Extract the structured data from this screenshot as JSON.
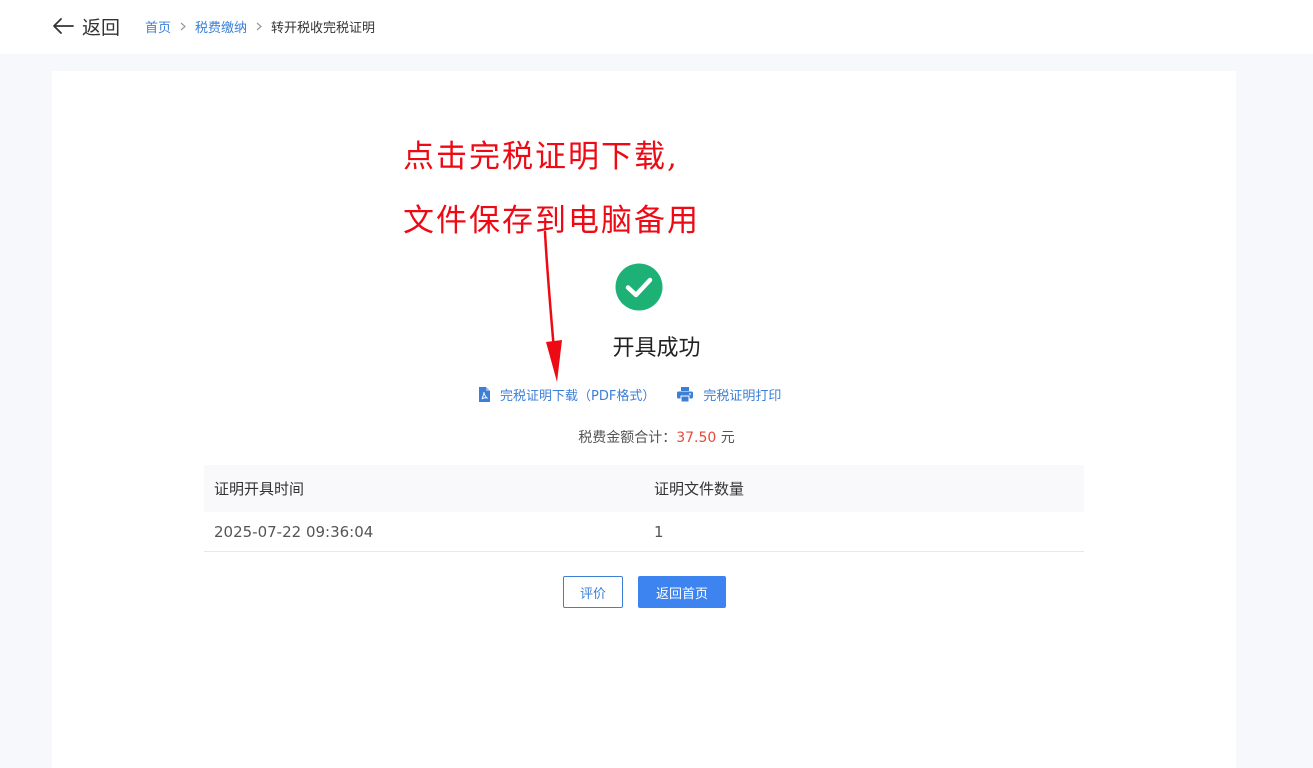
{
  "header": {
    "back_label": "返回",
    "breadcrumb": {
      "home": "首页",
      "section": "税费缴纳",
      "current": "转开税收完税证明"
    }
  },
  "annotation": {
    "line1": "点击完税证明下载,",
    "line2": "文件保存到电脑备用"
  },
  "result": {
    "title": "开具成功",
    "download_link": "完税证明下载（PDF格式）",
    "print_link": "完税证明打印",
    "summary_label": "税费金额合计：",
    "amount": "37.50",
    "currency": "元"
  },
  "table": {
    "headers": [
      "证明开具时间",
      "证明文件数量"
    ],
    "rows": [
      [
        "2025-07-22 09:36:04",
        "1"
      ]
    ]
  },
  "actions": {
    "review": "评价",
    "home": "返回首页"
  },
  "colors": {
    "link": "#3c7fd6",
    "primary": "#3d84f0",
    "success": "#1eb176",
    "amount": "#e4493c",
    "annotation": "#ee0a14"
  }
}
